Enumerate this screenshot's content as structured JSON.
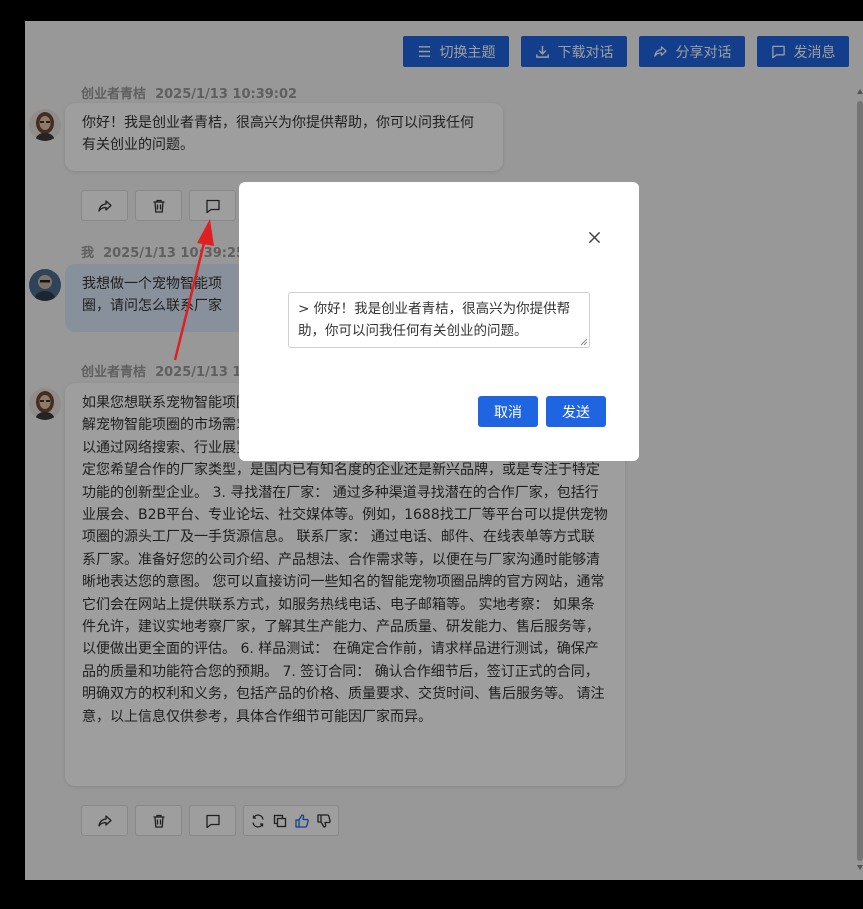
{
  "toolbar": {
    "theme_label": "切换主题",
    "download_label": "下载对话",
    "share_label": "分享对话",
    "send_label": "发消息"
  },
  "messages": [
    {
      "author": "创业者青桔",
      "time": "2025/1/13 10:39:02",
      "text": "你好！我是创业者青桔，很高兴为你提供帮助，你可以问我任何有关创业的问题。"
    },
    {
      "author": "我",
      "time": "2025/1/13 10:39:25",
      "text": "我想做一个宠物智能项圈，请问怎么联系厂家"
    },
    {
      "author": "创业者青桔",
      "time": "2025/1/13 10:39:33",
      "text": "如果您想联系宠物智能项圈的厂家，可以参考以下步骤：1. 首先，进行市场调研，了解宠物智能项圈的市场需求和竞争情况，以便确定您的产品定位和目标客户群体。可以通过网络搜索、行业展览会等方式获取信息。 确定合作目标： 根据调研结果，确定您希望合作的厂家类型，是国内已有知名度的企业还是新兴品牌，或是专注于特定功能的创新型企业。 3. 寻找潜在厂家： 通过多种渠道寻找潜在的合作厂家，包括行业展会、B2B平台、专业论坛、社交媒体等。例如，1688找工厂等平台可以提供宠物项圈的源头工厂及一手货源信息。 联系厂家： 通过电话、邮件、在线表单等方式联系厂家。准备好您的公司介绍、产品想法、合作需求等，以便在与厂家沟通时能够清晰地表达您的意图。 您可以直接访问一些知名的智能宠物项圈品牌的官方网站，通常它们会在网站上提供联系方式，如服务热线电话、电子邮箱等。 实地考察： 如果条件允许，建议实地考察厂家，了解其生产能力、产品质量、研发能力、售后服务等，以便做出更全面的评估。 6. 样品测试： 在确定合作前，请求样品进行测试，确保产品的质量和功能符合您的预期。 7. 签订合同： 确认合作细节后，签订正式的合同，明确双方的权利和义务，包括产品的价格、质量要求、交货时间、售后服务等。 请注意，以上信息仅供参考，具体合作细节可能因厂家而异。"
    }
  ],
  "modal": {
    "quote_text": "> 你好！我是创业者青桔，很高兴为你提供帮助，你可以问我任何有关创业的问题。",
    "cancel_label": "取消",
    "send_label": "发送"
  },
  "colors": {
    "primary": "#1f64e0",
    "arrow": "#e02020"
  }
}
